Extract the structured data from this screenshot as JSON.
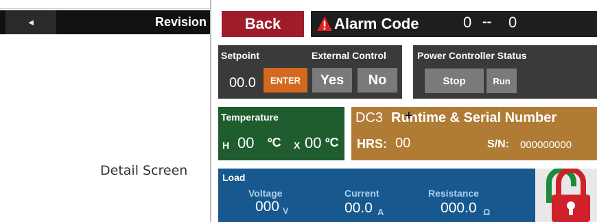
{
  "background": {
    "prev_icon": "◄",
    "revision_label": "Revision",
    "caption": "Detail Screen"
  },
  "panel": {
    "back_label": "Back",
    "alarm": {
      "icon": "warning-icon",
      "label": "Alarm Code",
      "value_a": "0",
      "separator": "--",
      "value_b": "0"
    },
    "setpoint": {
      "header": "Setpoint",
      "value": "00.0",
      "enter_label": "ENTER"
    },
    "external_control": {
      "header": "External Control",
      "yes_label": "Yes",
      "no_label": "No"
    },
    "power_controller": {
      "header": "Power Controller Status",
      "stop_label": "Stop",
      "run_label": "Run"
    },
    "temperature": {
      "header": "Temperature",
      "h_label": "H",
      "h_value": "00",
      "h_unit": "ºC",
      "x_label": "X",
      "x_value": "00",
      "x_unit": "ºC"
    },
    "runtime": {
      "prefix": "DC3",
      "title": "Runtime & Serial Number",
      "hrs_label": "HRS:",
      "hrs_value": "00",
      "sn_label": "S/N:",
      "sn_value": "000000000"
    },
    "load": {
      "header": "Load",
      "voltage_label": "Voltage",
      "voltage_value": "000",
      "voltage_unit": "V",
      "current_label": "Current",
      "current_value": "00.0",
      "current_unit": "A",
      "resistance_label": "Resistance",
      "resistance_value": "000.0",
      "resistance_unit": "Ω"
    },
    "lock": {
      "icon": "unlocked-padlock-icon"
    }
  },
  "colors": {
    "back": "#9f1d2a",
    "alarm_bar": "#1e1e1e",
    "control_box": "#3a3a3a",
    "enter": "#d2691e",
    "button_gray": "#7a7a7a",
    "temperature": "#1f5c2e",
    "runtime": "#b07c35",
    "load": "#17598e",
    "lock_red": "#d0202a",
    "lock_shackle": "#1f8a3a"
  }
}
